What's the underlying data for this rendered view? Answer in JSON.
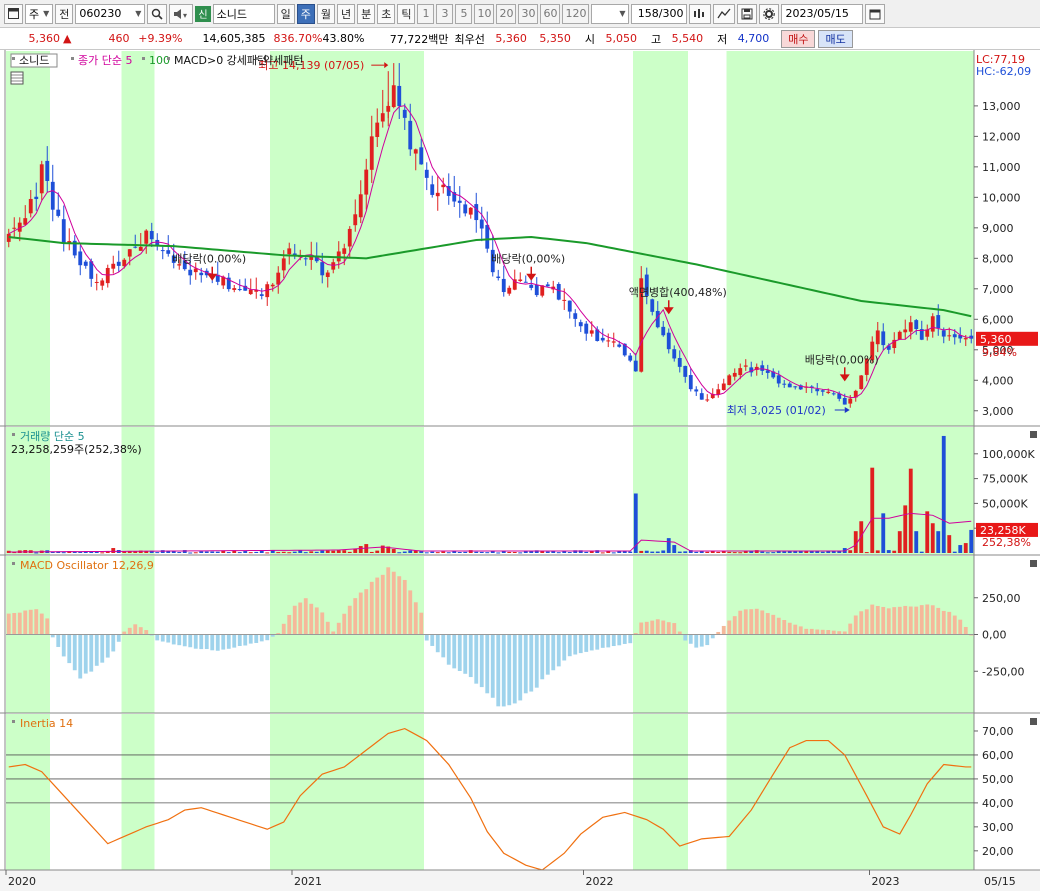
{
  "toolbar": {
    "chart_type": "주",
    "prev_label": "전",
    "stock_code": "060230",
    "new_badge": "신",
    "stock_name": "소니드",
    "periods": [
      "일",
      "주",
      "월",
      "년",
      "분",
      "초",
      "틱"
    ],
    "active_period": "주",
    "intervals": [
      "1",
      "3",
      "5",
      "10",
      "20",
      "30",
      "60",
      "120"
    ],
    "count_value": "158",
    "count_total": "/300",
    "date": "2023/05/15"
  },
  "quote": {
    "price": "5,360",
    "arrow": "▲",
    "change": "460",
    "change_pct": "+9.39%",
    "volume": "14,605,385",
    "volume_ratio": "836.70%",
    "turnover": "43.80%",
    "amount": "77,722백만",
    "best_ask_label": "최우선",
    "best_ask": "5,360",
    "best_bid": "5,350",
    "open_label": "시",
    "open": "5,050",
    "high_label": "고",
    "high": "5,540",
    "low_label": "저",
    "low": "4,700",
    "buy_label": "매수",
    "sell_label": "매도"
  },
  "colors": {
    "up": "#e02020",
    "down": "#1e4fd8",
    "ma": "#d0009c",
    "ma100": "#1a9a2a",
    "highlight": "#ccffc8",
    "inertia": "#f07010",
    "macd_pos": "#f5b89a",
    "macd_neg": "#9fd3ec",
    "vol_ma": "#d0009c",
    "last_badge": "#e81818"
  },
  "chart_data": [
    {
      "type": "candlestick",
      "panel": "price",
      "legend": [
        "소니드",
        "종가 단순 5",
        "100",
        "MACD>0 강세패턴",
        "약세패턴"
      ],
      "lc_label": "LC:77,19",
      "hc_label": "HC:-62,09",
      "x_dates": [
        "2020",
        "2021",
        "2022",
        "2023",
        "05/15"
      ],
      "y_ticks": [
        "13,000",
        "12,000",
        "11,000",
        "10,000",
        "9,000",
        "8,000",
        "7,000",
        "6,000",
        "5,000",
        "4,000",
        "3,000"
      ],
      "ylim": [
        2500,
        14800
      ],
      "n_weeks": 176,
      "anchors": [
        [
          0,
          8700
        ],
        [
          2,
          9300
        ],
        [
          5,
          10000
        ],
        [
          6,
          11000
        ],
        [
          8,
          9800
        ],
        [
          10,
          8600
        ],
        [
          13,
          7900
        ],
        [
          16,
          7200
        ],
        [
          19,
          7800
        ],
        [
          22,
          8100
        ],
        [
          25,
          8800
        ],
        [
          27,
          8300
        ],
        [
          30,
          7800
        ],
        [
          35,
          7400
        ],
        [
          38,
          7300
        ],
        [
          42,
          7000
        ],
        [
          46,
          6800
        ],
        [
          48,
          7300
        ],
        [
          51,
          8300
        ],
        [
          54,
          8200
        ],
        [
          57,
          7500
        ],
        [
          59,
          7900
        ],
        [
          61,
          8500
        ],
        [
          64,
          10200
        ],
        [
          66,
          11800
        ],
        [
          68,
          12600
        ],
        [
          70,
          13400
        ],
        [
          72,
          12400
        ],
        [
          74,
          11300
        ],
        [
          77,
          10300
        ],
        [
          80,
          10100
        ],
        [
          83,
          9700
        ],
        [
          86,
          8900
        ],
        [
          88,
          7600
        ],
        [
          90,
          7000
        ],
        [
          93,
          7200
        ],
        [
          96,
          6900
        ],
        [
          99,
          7100
        ],
        [
          101,
          6500
        ],
        [
          104,
          5800
        ],
        [
          107,
          5400
        ],
        [
          110,
          5200
        ],
        [
          113,
          4600
        ],
        [
          114,
          4200
        ],
        [
          115,
          7300
        ],
        [
          118,
          5800
        ],
        [
          121,
          4800
        ],
        [
          124,
          3700
        ],
        [
          126,
          3400
        ],
        [
          128,
          3500
        ],
        [
          131,
          4200
        ],
        [
          134,
          4400
        ],
        [
          137,
          4300
        ],
        [
          140,
          3900
        ],
        [
          143,
          3800
        ],
        [
          146,
          3700
        ],
        [
          149,
          3700
        ],
        [
          152,
          3200
        ],
        [
          154,
          3700
        ],
        [
          156,
          4800
        ],
        [
          158,
          5500
        ],
        [
          160,
          5000
        ],
        [
          162,
          5600
        ],
        [
          164,
          5800
        ],
        [
          166,
          5400
        ],
        [
          168,
          6000
        ],
        [
          170,
          5500
        ],
        [
          173,
          5300
        ],
        [
          175,
          5360
        ]
      ],
      "ma100_anchors": [
        [
          0,
          8700
        ],
        [
          10,
          8500
        ],
        [
          30,
          8400
        ],
        [
          50,
          8100
        ],
        [
          65,
          8000
        ],
        [
          75,
          8300
        ],
        [
          85,
          8600
        ],
        [
          95,
          8700
        ],
        [
          105,
          8500
        ],
        [
          125,
          7800
        ],
        [
          140,
          7200
        ],
        [
          155,
          6600
        ],
        [
          170,
          6300
        ],
        [
          175,
          6100
        ]
      ],
      "highlight_ranges": [
        [
          0,
          7
        ],
        [
          21,
          26
        ],
        [
          48,
          75
        ],
        [
          114,
          123
        ],
        [
          131,
          175
        ]
      ],
      "last_price_label": "5,360",
      "last_pct_label": "9,84%",
      "annotations": [
        {
          "text": "최고 14,139 (07/05)",
          "week": 69,
          "value": 14139,
          "kind": "high"
        },
        {
          "text": "최저 3,025 (01/02)",
          "week": 152,
          "value": 3025,
          "kind": "low"
        },
        {
          "text": "배당락(0.00%)",
          "week": 37,
          "value": 7200,
          "kind": "marker"
        },
        {
          "text": "배당락(0,00%)",
          "week": 95,
          "value": 7200,
          "kind": "marker"
        },
        {
          "text": "액면병합(400,48%)",
          "week": 120,
          "value": 6100,
          "kind": "marker"
        },
        {
          "text": "배당락(0,00%)",
          "week": 152,
          "value": 3900,
          "kind": "marker"
        }
      ]
    },
    {
      "type": "bar",
      "panel": "volume",
      "title": "거래량 단순 5",
      "subtitle": "23,258,259주(252,38%)",
      "y_ticks": [
        "100,000K",
        "75,000K",
        "50,000K",
        "25,000K"
      ],
      "ylim": [
        0,
        125000
      ],
      "last_label": "23,258K",
      "last_pct_label": "252,38%",
      "spikes": [
        [
          19,
          5000
        ],
        [
          20,
          3000
        ],
        [
          63,
          4000
        ],
        [
          64,
          7000
        ],
        [
          65,
          9000
        ],
        [
          68,
          7500
        ],
        [
          69,
          6500
        ],
        [
          70,
          4000
        ],
        [
          114,
          60000
        ],
        [
          120,
          15000
        ],
        [
          121,
          8000
        ],
        [
          152,
          5000
        ],
        [
          154,
          22000
        ],
        [
          155,
          32000
        ],
        [
          157,
          86000
        ],
        [
          159,
          40000
        ],
        [
          162,
          22000
        ],
        [
          163,
          48000
        ],
        [
          164,
          85000
        ],
        [
          165,
          22000
        ],
        [
          167,
          42000
        ],
        [
          168,
          30000
        ],
        [
          169,
          22000
        ],
        [
          170,
          118000
        ],
        [
          171,
          18000
        ],
        [
          173,
          8000
        ],
        [
          174,
          10000
        ],
        [
          175,
          23258
        ]
      ],
      "ma_anchors": [
        [
          0,
          1000
        ],
        [
          60,
          3000
        ],
        [
          68,
          6000
        ],
        [
          75,
          2000
        ],
        [
          113,
          2000
        ],
        [
          115,
          13000
        ],
        [
          121,
          11000
        ],
        [
          124,
          2000
        ],
        [
          152,
          2000
        ],
        [
          154,
          8000
        ],
        [
          157,
          35000
        ],
        [
          160,
          35000
        ],
        [
          164,
          40000
        ],
        [
          168,
          38000
        ],
        [
          171,
          30000
        ],
        [
          175,
          32000
        ]
      ]
    },
    {
      "type": "bar",
      "panel": "macd",
      "title": "MACD Oscillator 12,26,9",
      "y_ticks": [
        "250,00",
        "0,00",
        "-250,00"
      ],
      "ylim": [
        -500,
        500
      ],
      "anchors": [
        [
          0,
          140
        ],
        [
          5,
          170
        ],
        [
          7,
          110
        ],
        [
          8,
          -20
        ],
        [
          10,
          -150
        ],
        [
          13,
          -300
        ],
        [
          16,
          -220
        ],
        [
          19,
          -120
        ],
        [
          21,
          20
        ],
        [
          23,
          70
        ],
        [
          25,
          30
        ],
        [
          27,
          -40
        ],
        [
          33,
          -90
        ],
        [
          38,
          -110
        ],
        [
          42,
          -80
        ],
        [
          47,
          -40
        ],
        [
          49,
          10
        ],
        [
          52,
          200
        ],
        [
          54,
          240
        ],
        [
          57,
          150
        ],
        [
          59,
          20
        ],
        [
          62,
          200
        ],
        [
          66,
          360
        ],
        [
          69,
          450
        ],
        [
          72,
          380
        ],
        [
          75,
          150
        ],
        [
          76,
          -40
        ],
        [
          80,
          -200
        ],
        [
          84,
          -300
        ],
        [
          88,
          -440
        ],
        [
          90,
          -500
        ],
        [
          93,
          -440
        ],
        [
          96,
          -350
        ],
        [
          99,
          -250
        ],
        [
          102,
          -150
        ],
        [
          107,
          -100
        ],
        [
          113,
          -60
        ],
        [
          115,
          80
        ],
        [
          118,
          100
        ],
        [
          121,
          80
        ],
        [
          123,
          -40
        ],
        [
          125,
          -90
        ],
        [
          127,
          -70
        ],
        [
          130,
          60
        ],
        [
          133,
          160
        ],
        [
          136,
          180
        ],
        [
          139,
          130
        ],
        [
          142,
          80
        ],
        [
          145,
          40
        ],
        [
          149,
          30
        ],
        [
          152,
          20
        ],
        [
          154,
          130
        ],
        [
          157,
          200
        ],
        [
          160,
          180
        ],
        [
          164,
          190
        ],
        [
          168,
          200
        ],
        [
          171,
          150
        ],
        [
          173,
          100
        ],
        [
          175,
          0
        ]
      ]
    },
    {
      "type": "line",
      "panel": "inertia",
      "title": "Inertia 14",
      "y_ticks": [
        "70,00",
        "60,00",
        "50,00",
        "40,00",
        "30,00",
        "20,00"
      ],
      "ylim": [
        12,
        75
      ],
      "ref_lines": [
        60,
        50,
        40
      ],
      "anchors": [
        [
          0,
          55
        ],
        [
          3,
          56
        ],
        [
          6,
          53
        ],
        [
          10,
          43
        ],
        [
          14,
          33
        ],
        [
          18,
          23
        ],
        [
          21,
          26
        ],
        [
          25,
          30
        ],
        [
          29,
          33
        ],
        [
          32,
          37
        ],
        [
          35,
          38
        ],
        [
          39,
          35
        ],
        [
          43,
          32
        ],
        [
          47,
          29
        ],
        [
          50,
          32
        ],
        [
          53,
          43
        ],
        [
          57,
          52
        ],
        [
          61,
          55
        ],
        [
          65,
          62
        ],
        [
          69,
          69
        ],
        [
          72,
          71
        ],
        [
          76,
          66
        ],
        [
          80,
          56
        ],
        [
          84,
          42
        ],
        [
          87,
          28
        ],
        [
          90,
          19
        ],
        [
          94,
          14
        ],
        [
          97,
          12
        ],
        [
          101,
          19
        ],
        [
          104,
          27
        ],
        [
          108,
          34
        ],
        [
          112,
          36
        ],
        [
          116,
          33
        ],
        [
          119,
          29
        ],
        [
          122,
          22
        ],
        [
          126,
          25
        ],
        [
          131,
          26
        ],
        [
          135,
          37
        ],
        [
          139,
          52
        ],
        [
          142,
          63
        ],
        [
          145,
          66
        ],
        [
          149,
          66
        ],
        [
          152,
          60
        ],
        [
          156,
          43
        ],
        [
          159,
          30
        ],
        [
          162,
          27
        ],
        [
          164,
          35
        ],
        [
          167,
          48
        ],
        [
          170,
          56
        ],
        [
          174,
          55
        ],
        [
          178,
          54
        ],
        [
          181,
          55
        ],
        [
          175,
          55
        ]
      ]
    }
  ]
}
